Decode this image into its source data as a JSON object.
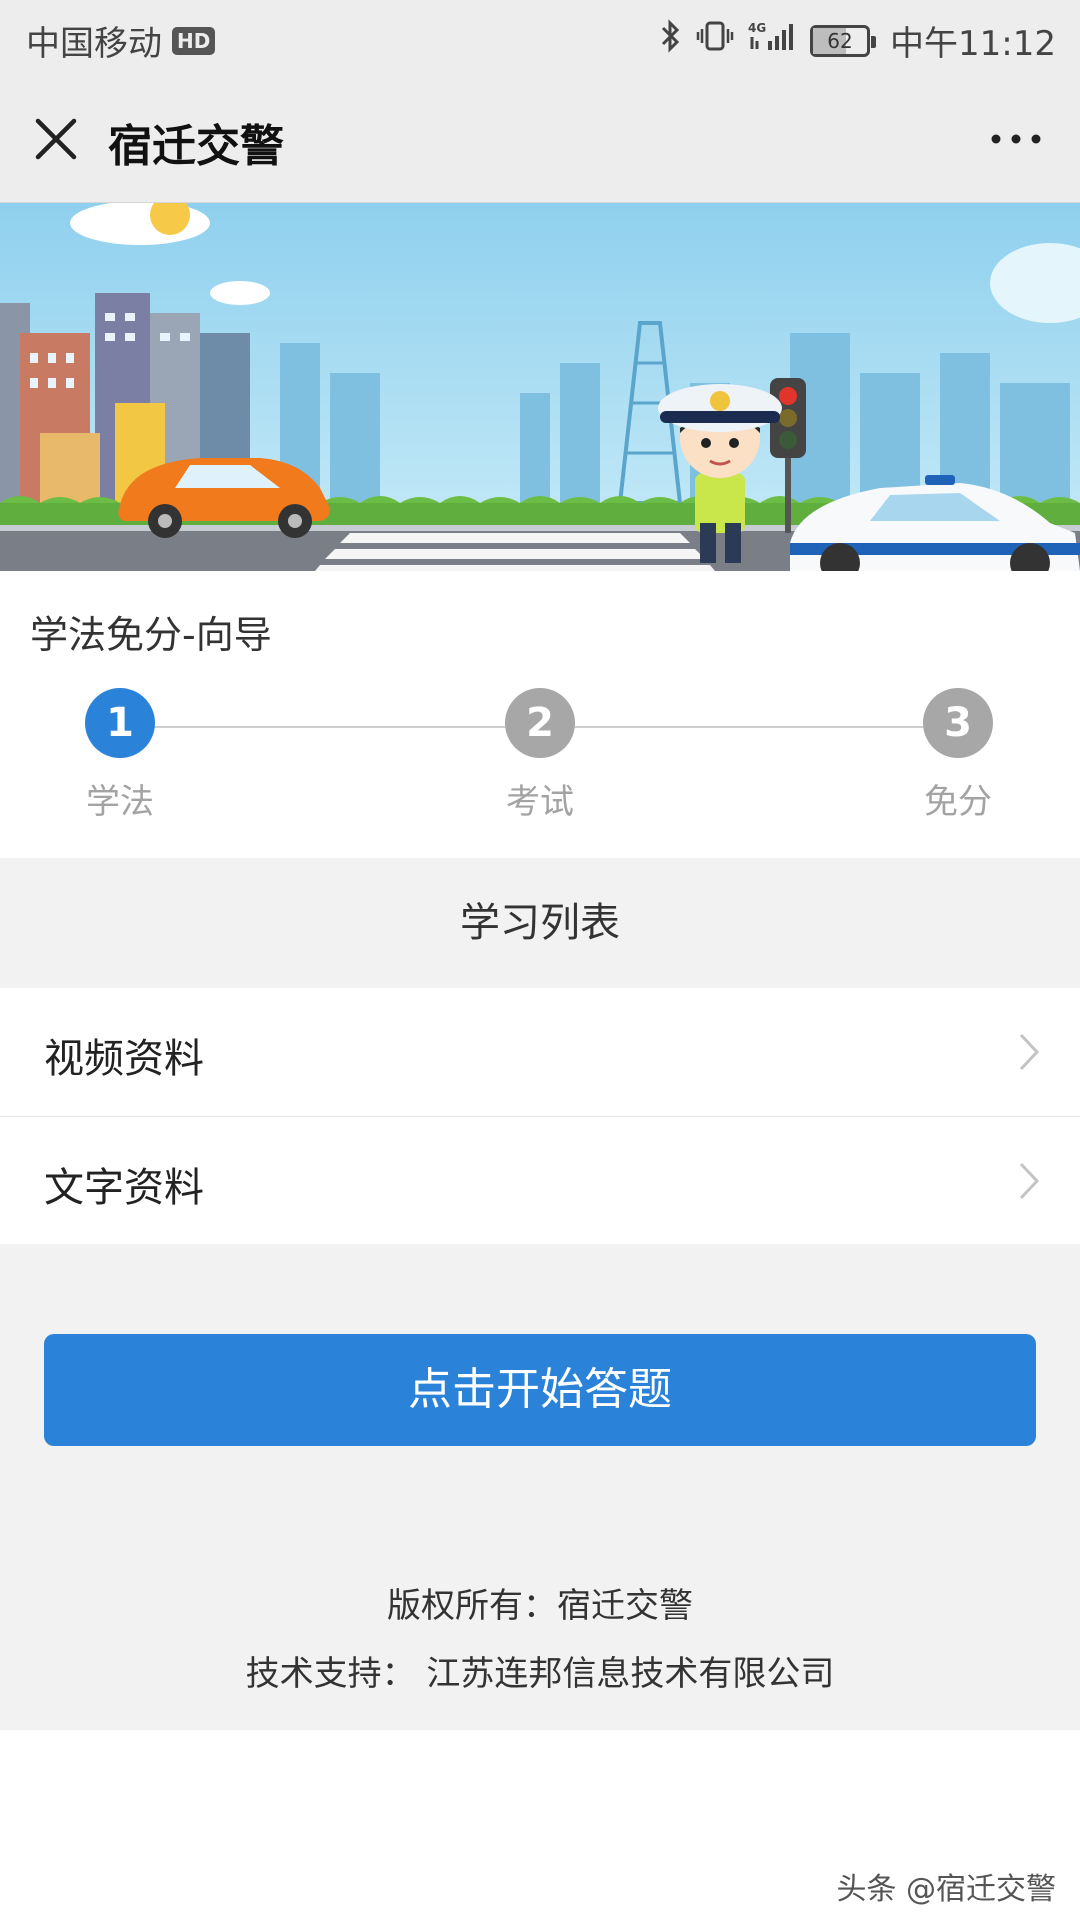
{
  "status_bar": {
    "carrier": "中国移动",
    "hd_badge": "HD",
    "network": "4G",
    "battery": "62",
    "battery_level": 0.62,
    "time": "中午11:12",
    "icons": [
      "bluetooth-icon",
      "vibrate-icon",
      "signal-icon",
      "battery-icon"
    ]
  },
  "nav": {
    "title": "宿迁交警",
    "icons": [
      "close-icon",
      "more-icon"
    ]
  },
  "wizard": {
    "title": "学法免分-向导",
    "steps": [
      {
        "number": "1",
        "label": "学法",
        "active": true
      },
      {
        "number": "2",
        "label": "考试",
        "active": false
      },
      {
        "number": "3",
        "label": "免分",
        "active": false
      }
    ],
    "active_color": "#2a83d9",
    "inactive_color": "#a7a7a7"
  },
  "study_list": {
    "header": "学习列表",
    "items": [
      {
        "label": "视频资料"
      },
      {
        "label": "文字资料"
      }
    ]
  },
  "start_button": {
    "label": "点击开始答题",
    "color": "#2a83d9"
  },
  "footer": {
    "copyright": "版权所有：宿迁交警",
    "support": "技术支持： 江苏连邦信息技术有限公司"
  },
  "watermark": "头条 @宿迁交警"
}
